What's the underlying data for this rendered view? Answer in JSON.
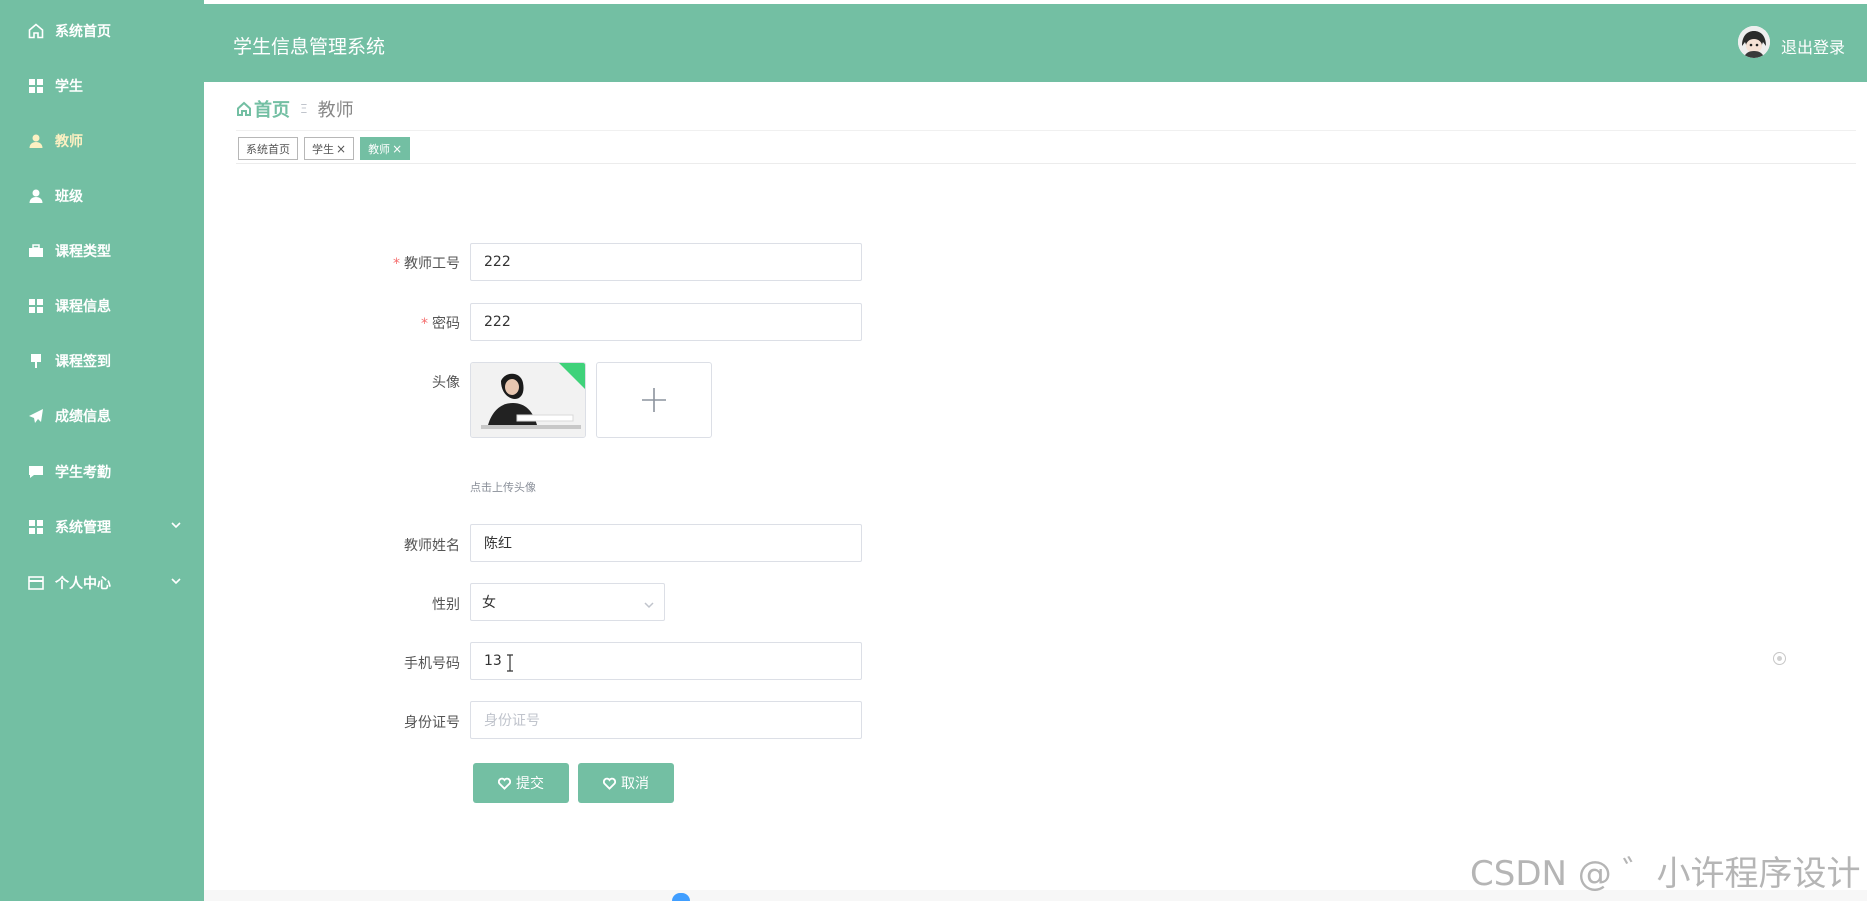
{
  "header": {
    "title": "学生信息管理系统",
    "logout_label": "退出登录"
  },
  "sidebar": {
    "items": [
      {
        "label": "系统首页",
        "icon": "home-icon"
      },
      {
        "label": "学生",
        "icon": "grid-icon"
      },
      {
        "label": "教师",
        "icon": "user-icon",
        "active": true
      },
      {
        "label": "班级",
        "icon": "user-icon"
      },
      {
        "label": "课程类型",
        "icon": "briefcase-icon"
      },
      {
        "label": "课程信息",
        "icon": "grid-icon"
      },
      {
        "label": "课程签到",
        "icon": "pin-icon"
      },
      {
        "label": "成绩信息",
        "icon": "send-icon"
      },
      {
        "label": "学生考勤",
        "icon": "comment-icon"
      },
      {
        "label": "系统管理",
        "icon": "grid-icon",
        "expandable": true
      },
      {
        "label": "个人中心",
        "icon": "card-icon",
        "expandable": true
      }
    ]
  },
  "breadcrumb": {
    "home": "首页",
    "separator": "Ξ",
    "current": "教师"
  },
  "tags": [
    {
      "label": "系统首页",
      "closable": false
    },
    {
      "label": "学生",
      "closable": true
    },
    {
      "label": "教师",
      "closable": true,
      "active": true
    }
  ],
  "form": {
    "teacher_id": {
      "label": "教师工号",
      "required": true,
      "value": "222"
    },
    "password": {
      "label": "密码",
      "required": true,
      "value": "222"
    },
    "avatar": {
      "label": "头像",
      "hint": "点击上传头像"
    },
    "name": {
      "label": "教师姓名",
      "value": "陈红"
    },
    "gender": {
      "label": "性别",
      "value": "女"
    },
    "phone": {
      "label": "手机号码",
      "value": "13"
    },
    "id_card": {
      "label": "身份证号",
      "placeholder": "身份证号"
    },
    "submit_label": "提交",
    "cancel_label": "取消"
  },
  "watermark": "CSDN @ ゛小许程序设计",
  "colors": {
    "primary": "#73bfa3",
    "active_menu": "#fdf0c2",
    "required": "#f56c6c"
  }
}
